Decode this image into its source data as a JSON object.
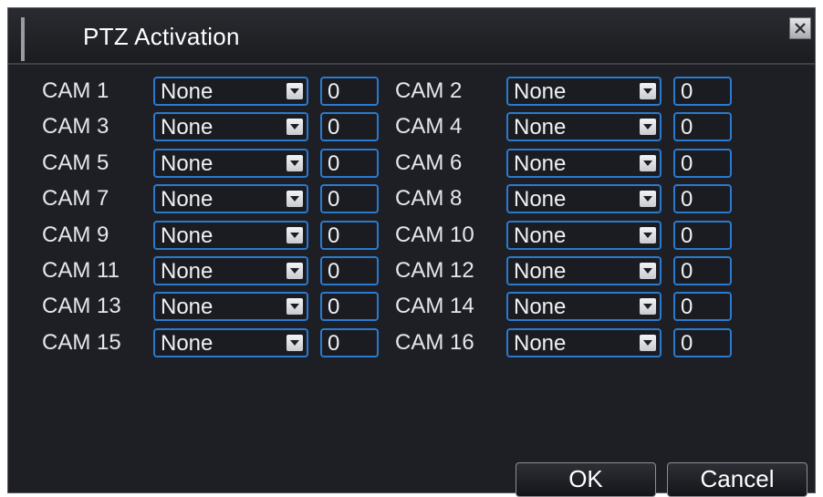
{
  "dialog": {
    "title": "PTZ Activation",
    "close_icon": "close-icon"
  },
  "cameras": [
    {
      "label": "CAM 1",
      "mode": "None",
      "value": "0"
    },
    {
      "label": "CAM 2",
      "mode": "None",
      "value": "0"
    },
    {
      "label": "CAM 3",
      "mode": "None",
      "value": "0"
    },
    {
      "label": "CAM 4",
      "mode": "None",
      "value": "0"
    },
    {
      "label": "CAM 5",
      "mode": "None",
      "value": "0"
    },
    {
      "label": "CAM 6",
      "mode": "None",
      "value": "0"
    },
    {
      "label": "CAM 7",
      "mode": "None",
      "value": "0"
    },
    {
      "label": "CAM 8",
      "mode": "None",
      "value": "0"
    },
    {
      "label": "CAM 9",
      "mode": "None",
      "value": "0"
    },
    {
      "label": "CAM 10",
      "mode": "None",
      "value": "0"
    },
    {
      "label": "CAM 11",
      "mode": "None",
      "value": "0"
    },
    {
      "label": "CAM 12",
      "mode": "None",
      "value": "0"
    },
    {
      "label": "CAM 13",
      "mode": "None",
      "value": "0"
    },
    {
      "label": "CAM 14",
      "mode": "None",
      "value": "0"
    },
    {
      "label": "CAM 15",
      "mode": "None",
      "value": "0"
    },
    {
      "label": "CAM 16",
      "mode": "None",
      "value": "0"
    }
  ],
  "buttons": {
    "ok_label": "OK",
    "cancel_label": "Cancel"
  },
  "colors": {
    "background": "#1e1f24",
    "field_border": "#2a7ad0",
    "text": "#e6e7ea"
  }
}
